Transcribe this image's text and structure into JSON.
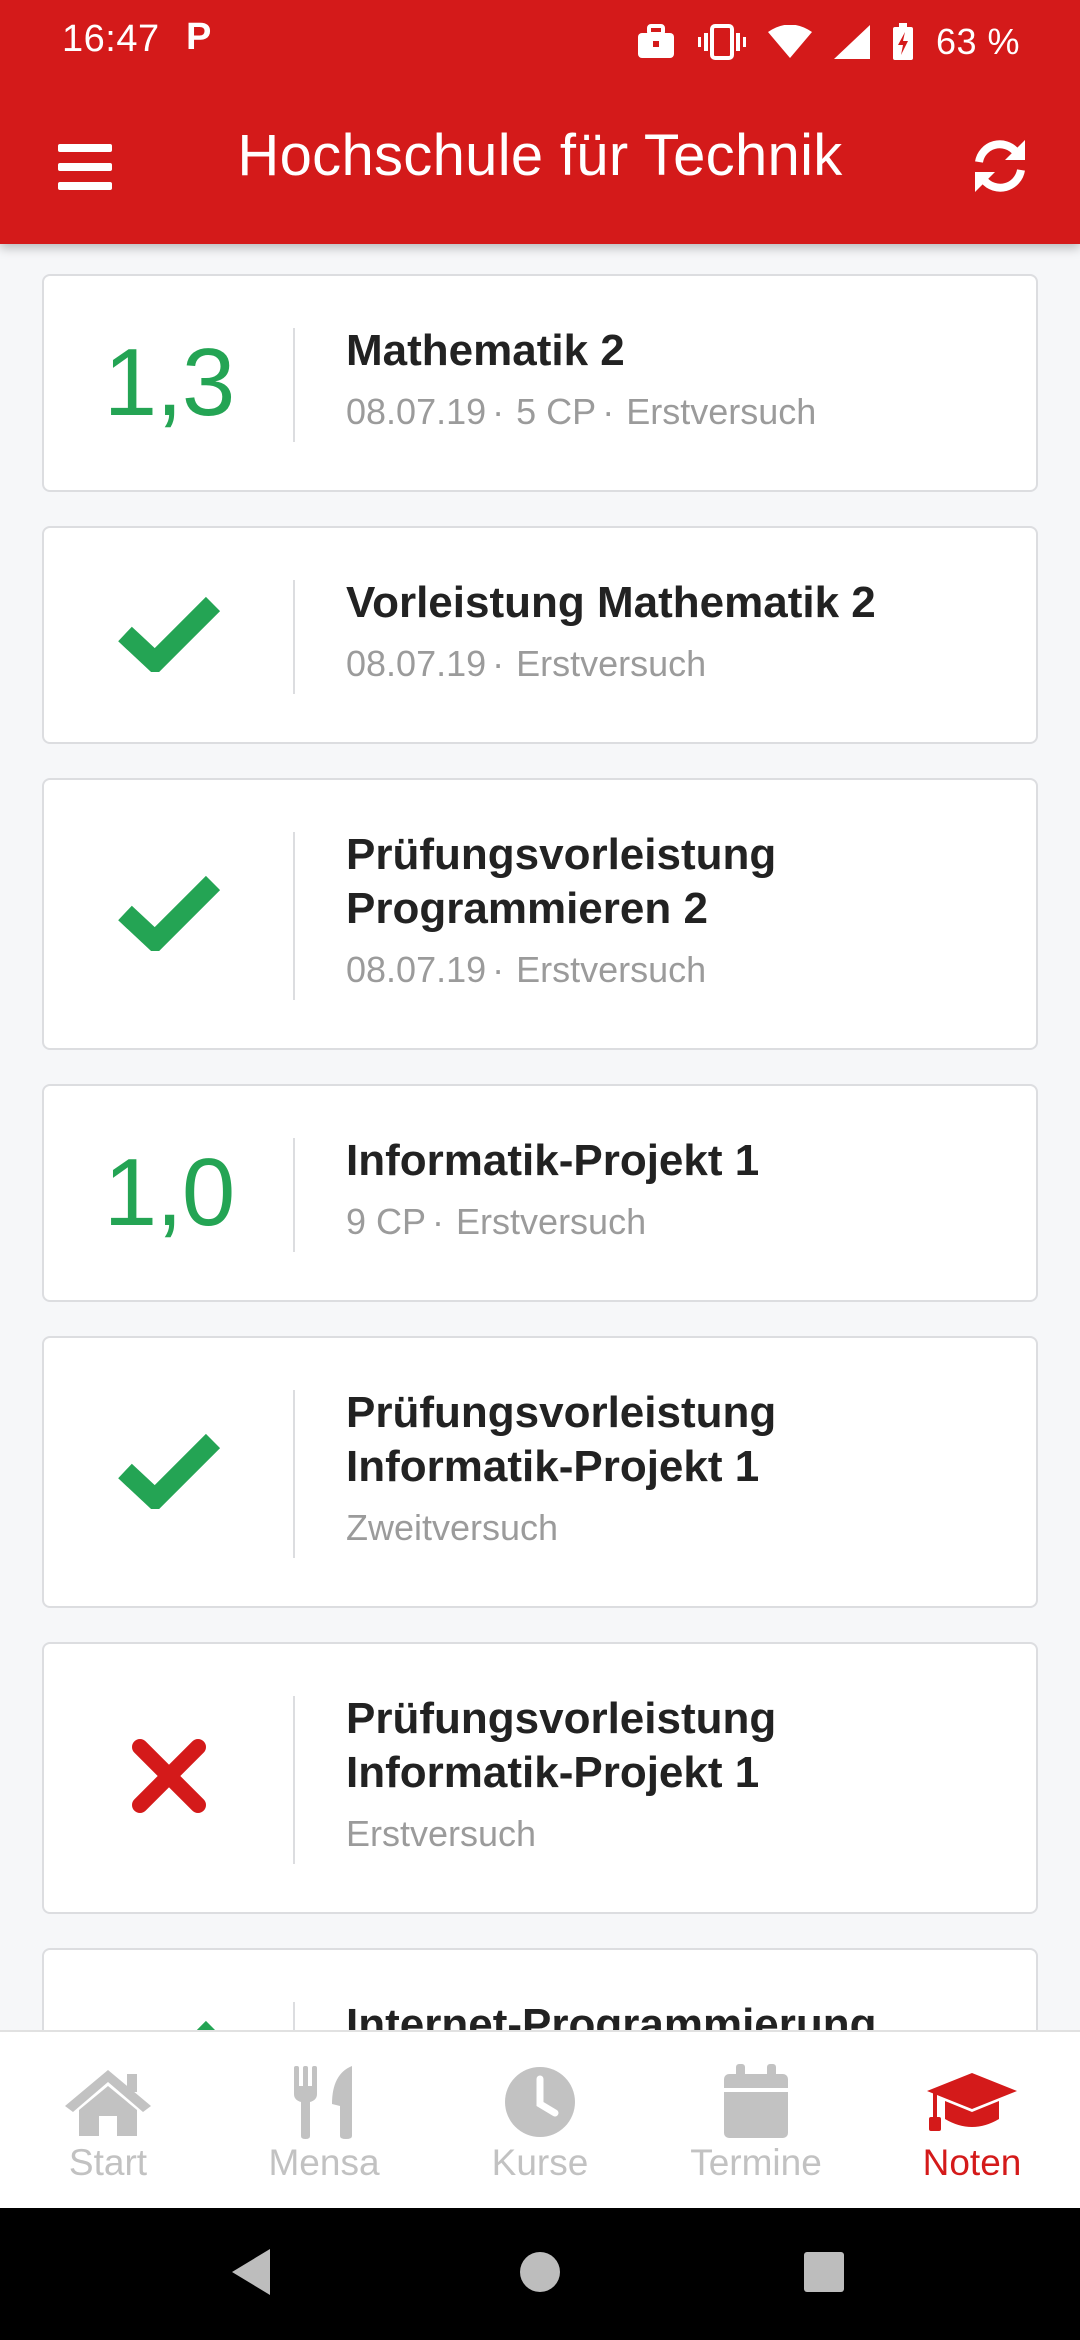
{
  "status_bar": {
    "time": "16:47",
    "notification_letter": "P",
    "battery_percent": "63 %",
    "icons": [
      "briefcase-icon",
      "vibrate-icon",
      "wifi-icon",
      "signal-icon",
      "battery-icon"
    ]
  },
  "app_bar": {
    "title": "Hochschule für Technik",
    "menu_icon": "hamburger-menu-icon",
    "refresh_icon": "refresh-icon"
  },
  "colors": {
    "brand_red": "#d41a1a",
    "pass_green": "#24a454",
    "fail_red": "#d41a1a",
    "meta_gray": "#9b9b9b",
    "inactive_nav": "#c2c2c2"
  },
  "results": [
    {
      "type": "grade",
      "grade": "1,3",
      "title_lines": [
        "Mathematik 2"
      ],
      "meta": [
        "08.07.19",
        "5 CP",
        "Erstversuch"
      ]
    },
    {
      "type": "passed",
      "icon": "check-icon",
      "title_lines": [
        "Vorleistung Mathematik 2"
      ],
      "meta": [
        "08.07.19",
        "Erstversuch"
      ]
    },
    {
      "type": "passed",
      "icon": "check-icon",
      "title_lines": [
        "Prüfungsvorleistung",
        "Programmieren 2"
      ],
      "meta": [
        "08.07.19",
        "Erstversuch"
      ]
    },
    {
      "type": "grade",
      "grade": "1,0",
      "title_lines": [
        "Informatik-Projekt 1"
      ],
      "meta": [
        "9 CP",
        "Erstversuch"
      ]
    },
    {
      "type": "passed",
      "icon": "check-icon",
      "title_lines": [
        "Prüfungsvorleistung",
        "Informatik-Projekt 1"
      ],
      "meta": [
        "Zweitversuch"
      ]
    },
    {
      "type": "failed",
      "icon": "cross-icon",
      "title_lines": [
        "Prüfungsvorleistung",
        "Informatik-Projekt 1"
      ],
      "meta": [
        "Erstversuch"
      ]
    },
    {
      "type": "passed",
      "icon": "check-icon",
      "title_lines": [
        "Internet-Programmierung"
      ],
      "meta": []
    }
  ],
  "bottom_nav": [
    {
      "label": "Start",
      "icon": "home-icon",
      "active": false
    },
    {
      "label": "Mensa",
      "icon": "fork-knife-icon",
      "active": false
    },
    {
      "label": "Kurse",
      "icon": "clock-icon",
      "active": false
    },
    {
      "label": "Termine",
      "icon": "calendar-icon",
      "active": false
    },
    {
      "label": "Noten",
      "icon": "graduation-cap-icon",
      "active": true
    }
  ],
  "system_nav": [
    "back-icon",
    "home-circle-icon",
    "recents-icon"
  ]
}
